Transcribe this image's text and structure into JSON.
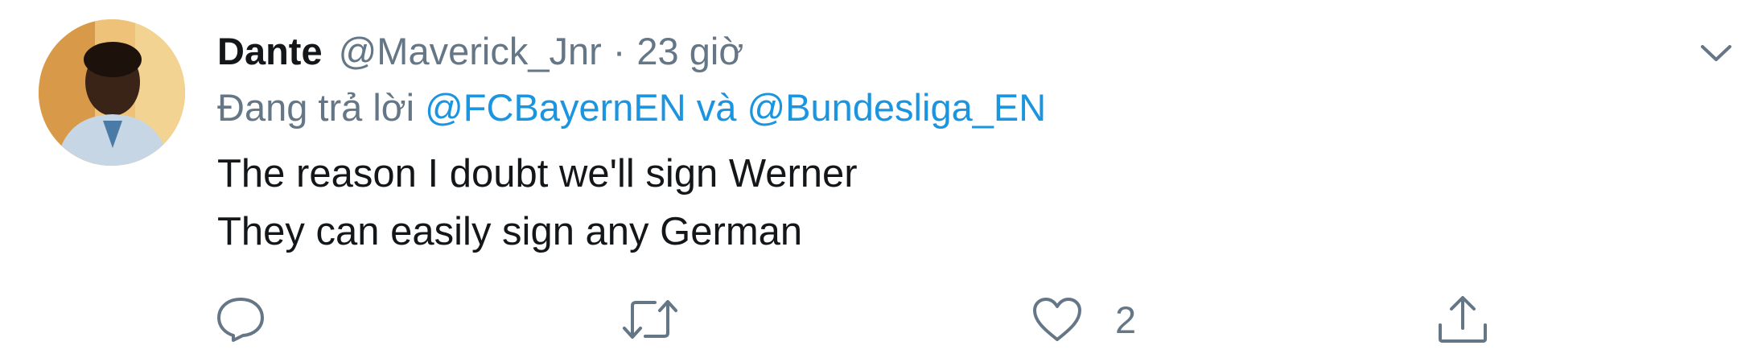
{
  "tweet": {
    "author": {
      "display_name": "Dante",
      "handle": "@Maverick_Jnr"
    },
    "separator": "·",
    "time": "23 giờ",
    "reply": {
      "prefix": "Đang trả lời",
      "mention_1": "@FCBayernEN",
      "conjunction": "và",
      "mention_2": "@Bundesliga_EN"
    },
    "text_lines": [
      "The reason I doubt we'll sign Werner",
      "They can easily sign any German"
    ],
    "actions": {
      "reply_icon": "reply-icon",
      "retweet_icon": "retweet-icon",
      "like_icon": "heart-icon",
      "like_count": "2",
      "share_icon": "share-icon"
    }
  },
  "colors": {
    "link": "#1b95e0",
    "secondary": "#657786",
    "primary_text": "#14171a"
  }
}
